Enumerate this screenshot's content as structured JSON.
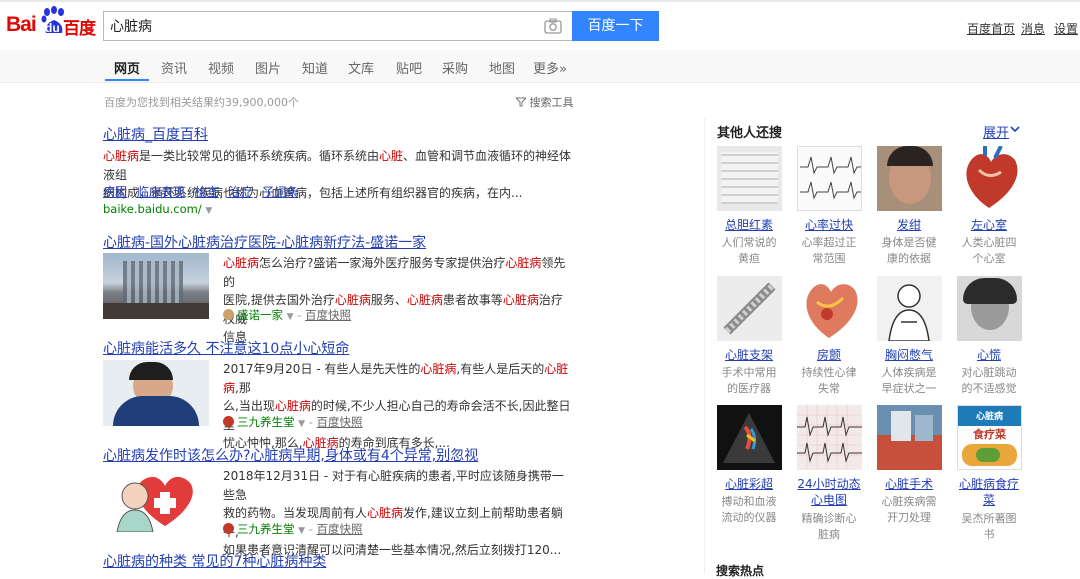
{
  "header": {
    "logo_text_left": "Bai",
    "logo_text_du": "du",
    "logo_text_right": "百度",
    "search_value": "心脏病",
    "search_button": "百度一下",
    "links": [
      "百度首页",
      "消息",
      "设置"
    ]
  },
  "nav": {
    "tabs": [
      "网页",
      "资讯",
      "视频",
      "图片",
      "知道",
      "文库",
      "贴吧",
      "采购",
      "地图",
      "更多»"
    ],
    "active_tab": "网页"
  },
  "result_count": "百度为您找到相关结果约39,900,000个",
  "search_tools": "搜索工具",
  "results": [
    {
      "title": "心脏病_百度百科",
      "snippet": [
        [
          "心脏病",
          "是一类比较常见的循环系统疾病。循环系统由",
          "心脏",
          "、血管和调节血液循环的神经体液组"
        ],
        [
          "织构成，循环系统疾病也称为心血管病，包括上述所有组织器官的疾病，在内..."
        ]
      ],
      "sublinks": [
        "病因",
        "临床表现",
        "检查",
        "治疗",
        "子词条"
      ],
      "url": "baike.baidu.com/"
    },
    {
      "title": "心脏病-国外心脏病治疗医院-心脏病新疗法-盛诺一家",
      "snippet": [
        "心脏病怎么治疗?盛诺一家海外医疗服务专家提供治疗心脏病领先的",
        "医院,提供去国外治疗心脏病服务、心脏病患者故事等心脏病治疗权威",
        "信息"
      ],
      "source": "盛诺一家",
      "cache": "百度快照"
    },
    {
      "title": "心脏病能活多久 不注意这10点小心短命",
      "snippet": [
        "2017年9月20日 - 有些人是先天性的心脏病,有些人是后天的心脏病,那",
        "么,当出现心脏病的时候,不少人担心自己的寿命会活不长,因此整日里",
        "忧心忡忡,那么,心脏病的寿命到底有多长,..."
      ],
      "source": "三九养生堂",
      "cache": "百度快照"
    },
    {
      "title": "心脏病发作时该怎么办?心脏病早期,身体或有4个异常,别忽视",
      "snippet": [
        "2018年12月31日 - 对于有心脏疾病的患者,平时应该随身携带一些急",
        "救的药物。当发现周前有人心脏病发作,建议立刻上前帮助患者躺平,",
        "如果患者意识清醒可以问清楚一些基本情况,然后立刻拨打120..."
      ],
      "source": "三九养生堂",
      "cache": "百度快照"
    },
    {
      "title": "心脏病的种类 常见的7种心脏病种类"
    }
  ],
  "right_panel": {
    "title": "其他人还搜",
    "expand": "展开",
    "cards": [
      {
        "name": "总胆红素",
        "desc": [
          "人们常说的",
          "黄疸"
        ]
      },
      {
        "name": "心率过快",
        "desc": [
          "心率超过正",
          "常范围"
        ]
      },
      {
        "name": "发绀",
        "desc": [
          "身体是否健",
          "康的依据"
        ]
      },
      {
        "name": "左心室",
        "desc": [
          "人类心脏四",
          "个心室"
        ]
      },
      {
        "name": "心脏支架",
        "desc": [
          "手术中常用",
          "的医疗器"
        ]
      },
      {
        "name": "房颤",
        "desc": [
          "持续性心律",
          "失常"
        ]
      },
      {
        "name": "胸闷憋气",
        "desc": [
          "人体疾病是",
          "早症状之一"
        ]
      },
      {
        "name": "心慌",
        "desc": [
          "对心脏跳动",
          "的不适感觉"
        ]
      },
      {
        "name": "心脏彩超",
        "desc": [
          "搏动和血液",
          "流动的仪器"
        ]
      },
      {
        "name": "24小时动态心电图",
        "desc": [
          "精确诊断心",
          "脏病"
        ]
      },
      {
        "name": "心脏手术",
        "desc": [
          "心脏疾病需",
          "开刀处理"
        ]
      },
      {
        "name": "心脏病食疗菜",
        "desc": [
          "吴杰所著图",
          "书"
        ]
      }
    ],
    "card9_name_lines": [
      "24小时动态",
      "心电图"
    ],
    "card12_name_lines": [
      "心脏病食疗",
      "菜"
    ],
    "card12_cover_title": "心脏病",
    "card12_cover_sub": "食疗菜",
    "bottom_partial": "搜索热点"
  },
  "colors": {
    "brand_blue": "#3385ff",
    "brand_red": "#e10602",
    "link": "#2440b3",
    "highlight": "#c00000",
    "url_green": "#008000"
  }
}
